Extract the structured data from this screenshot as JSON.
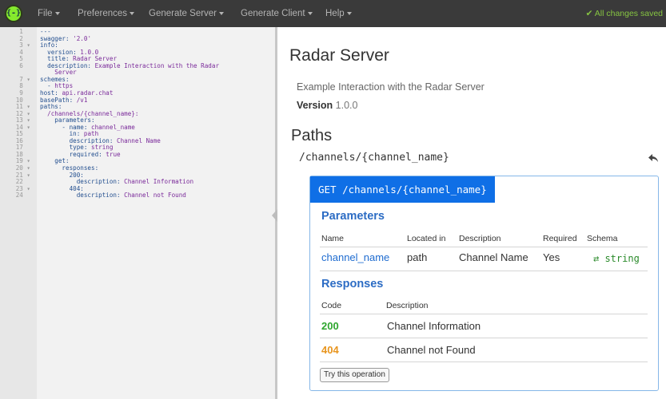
{
  "menu": {
    "logo_text": "{-}",
    "items": [
      {
        "label": "File"
      },
      {
        "label": "Preferences"
      },
      {
        "label": "Generate Server"
      },
      {
        "label": "Generate Client"
      },
      {
        "label": "Help"
      }
    ],
    "status": "✔ All changes saved"
  },
  "editor": {
    "lines": [
      {
        "n": "1",
        "fold": false,
        "parts": [
          {
            "t": "---",
            "c": "k"
          }
        ]
      },
      {
        "n": "2",
        "fold": false,
        "parts": [
          {
            "t": "swagger: ",
            "c": "k"
          },
          {
            "t": "'2.0'",
            "c": "v"
          }
        ]
      },
      {
        "n": "3",
        "fold": true,
        "parts": [
          {
            "t": "info:",
            "c": "k"
          }
        ]
      },
      {
        "n": "4",
        "fold": false,
        "parts": [
          {
            "t": "  version: ",
            "c": "k"
          },
          {
            "t": "1.0.0",
            "c": "v"
          }
        ]
      },
      {
        "n": "5",
        "fold": false,
        "parts": [
          {
            "t": "  title: ",
            "c": "k"
          },
          {
            "t": "Radar Server",
            "c": "v"
          }
        ]
      },
      {
        "n": "6",
        "fold": false,
        "parts": [
          {
            "t": "  description: ",
            "c": "k"
          },
          {
            "t": "Example Interaction with the Radar",
            "c": "v"
          }
        ]
      },
      {
        "n": "",
        "fold": false,
        "parts": [
          {
            "t": "    Server",
            "c": "v"
          }
        ]
      },
      {
        "n": "7",
        "fold": true,
        "parts": [
          {
            "t": "schemes:",
            "c": "k"
          }
        ]
      },
      {
        "n": "8",
        "fold": false,
        "parts": [
          {
            "t": "  - ",
            "c": "k"
          },
          {
            "t": "https",
            "c": "v"
          }
        ]
      },
      {
        "n": "9",
        "fold": false,
        "parts": [
          {
            "t": "host: ",
            "c": "k"
          },
          {
            "t": "api.radar.chat",
            "c": "v"
          }
        ]
      },
      {
        "n": "10",
        "fold": false,
        "parts": [
          {
            "t": "basePath: ",
            "c": "k"
          },
          {
            "t": "/v1",
            "c": "v"
          }
        ]
      },
      {
        "n": "11",
        "fold": true,
        "parts": [
          {
            "t": "paths:",
            "c": "k"
          }
        ]
      },
      {
        "n": "12",
        "fold": true,
        "parts": [
          {
            "t": "  /channels/{channel_name}:",
            "c": "v"
          }
        ]
      },
      {
        "n": "13",
        "fold": true,
        "parts": [
          {
            "t": "    parameters:",
            "c": "k"
          }
        ]
      },
      {
        "n": "14",
        "fold": true,
        "parts": [
          {
            "t": "      - name: ",
            "c": "k"
          },
          {
            "t": "channel_name",
            "c": "v"
          }
        ]
      },
      {
        "n": "15",
        "fold": false,
        "parts": [
          {
            "t": "        in: ",
            "c": "k"
          },
          {
            "t": "path",
            "c": "v"
          }
        ]
      },
      {
        "n": "16",
        "fold": false,
        "parts": [
          {
            "t": "        description: ",
            "c": "k"
          },
          {
            "t": "Channel Name",
            "c": "v"
          }
        ]
      },
      {
        "n": "17",
        "fold": false,
        "parts": [
          {
            "t": "        type: ",
            "c": "k"
          },
          {
            "t": "string",
            "c": "v"
          }
        ]
      },
      {
        "n": "18",
        "fold": false,
        "parts": [
          {
            "t": "        required: ",
            "c": "k"
          },
          {
            "t": "true",
            "c": "v"
          }
        ]
      },
      {
        "n": "19",
        "fold": true,
        "parts": [
          {
            "t": "    get:",
            "c": "k"
          }
        ]
      },
      {
        "n": "20",
        "fold": true,
        "parts": [
          {
            "t": "      responses:",
            "c": "k"
          }
        ]
      },
      {
        "n": "21",
        "fold": true,
        "parts": [
          {
            "t": "        200:",
            "c": "k"
          }
        ]
      },
      {
        "n": "22",
        "fold": false,
        "parts": [
          {
            "t": "          description: ",
            "c": "k"
          },
          {
            "t": "Channel Information",
            "c": "v"
          }
        ]
      },
      {
        "n": "23",
        "fold": true,
        "parts": [
          {
            "t": "        404:",
            "c": "k"
          }
        ]
      },
      {
        "n": "24",
        "fold": false,
        "parts": [
          {
            "t": "          description: ",
            "c": "k"
          },
          {
            "t": "Channel not Found",
            "c": "v"
          }
        ]
      }
    ]
  },
  "docs": {
    "title": "Radar Server",
    "description": "Example Interaction with the Radar Server",
    "version_label": "Version",
    "version": "1.0.0",
    "paths_title": "Paths",
    "path": "/channels/{channel_name}",
    "operation": {
      "header": "GET /channels/{channel_name}",
      "parameters_title": "Parameters",
      "param_headers": [
        "Name",
        "Located in",
        "Description",
        "Required",
        "Schema"
      ],
      "param_row": {
        "name": "channel_name",
        "in": "path",
        "description": "Channel Name",
        "required": "Yes",
        "schema": "⇄ string"
      },
      "responses_title": "Responses",
      "resp_headers": [
        "Code",
        "Description"
      ],
      "responses": [
        {
          "code": "200",
          "description": "Channel Information"
        },
        {
          "code": "404",
          "description": "Channel not Found"
        }
      ],
      "try_button": "Try this operation"
    }
  },
  "colors": {
    "menu_bg": "#3a3a3a",
    "saved": "#86c442",
    "op_header": "#0f6fe6",
    "ok": "#2ea62e",
    "warn": "#e8951e",
    "link": "#1f6cd0"
  }
}
